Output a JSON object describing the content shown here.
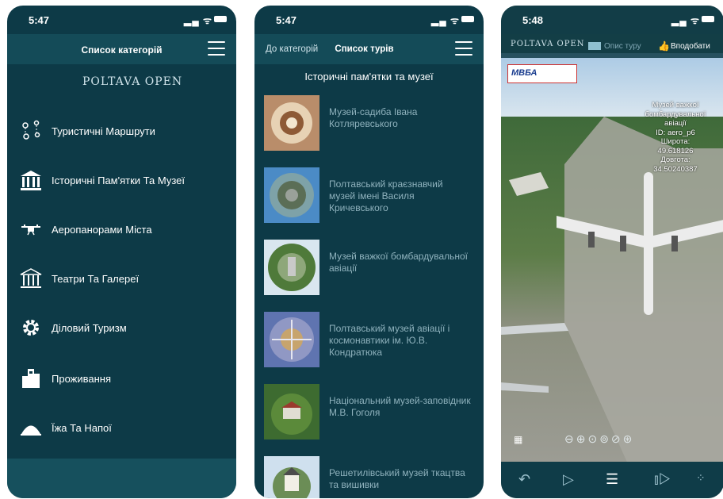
{
  "phone1": {
    "time": "5:47",
    "title": "Список категорій",
    "logo": "POLTAVA OPEN",
    "categories": [
      {
        "label": "Туристичні Маршрути",
        "icon": "map-pins-icon"
      },
      {
        "label": "Історичні Пам'ятки Та Музеї",
        "icon": "museum-icon"
      },
      {
        "label": "Аеропанорами Міста",
        "icon": "drone-icon"
      },
      {
        "label": "Театри Та Галереї",
        "icon": "theater-icon"
      },
      {
        "label": "Діловий Туризм",
        "icon": "gear-icon"
      },
      {
        "label": "Проживання",
        "icon": "hotel-icon"
      },
      {
        "label": "Їжа Та Напої",
        "icon": "cloche-icon"
      }
    ]
  },
  "phone2": {
    "time": "5:47",
    "tab_back": "До категорій",
    "tab_active": "Список турів",
    "section_title": "Історичні пам'ятки та музеї",
    "tours": [
      {
        "title": "Музей-садиба Івана Котляревського"
      },
      {
        "title": "Полтавський краєзнавчий музей імені Василя Кричевського"
      },
      {
        "title": "Музей важкої бомбардувальної авіації"
      },
      {
        "title": "Полтавський музей авіації і космонавтики ім. Ю.В. Кондратюка"
      },
      {
        "title": "Національний музей-заповідник М.В. Гоголя"
      },
      {
        "title": "Решетилівський музей ткацтва та вишивки"
      }
    ]
  },
  "phone3": {
    "time": "5:48",
    "logo": "POLTAVA OPEN",
    "desc_label": "Опис туру",
    "like_label": "Вподобати",
    "badge": "МВБА",
    "info": [
      "Музей важкої",
      "бомбардувальної",
      "авіації",
      "ID: aero_p6",
      "Широта:",
      "49.618126",
      "Довгота:",
      "34.50240387"
    ]
  }
}
